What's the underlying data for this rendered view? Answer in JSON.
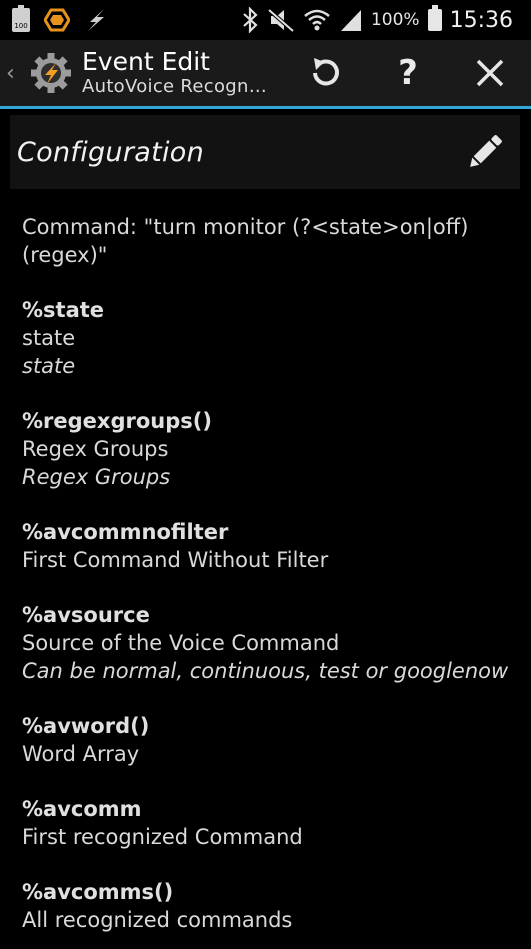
{
  "status_bar": {
    "battery_small_label": "100",
    "battery_percent": "100%",
    "time": "15:36",
    "icons": [
      "battery-small-icon",
      "hexagon-icon",
      "lightning-icon",
      "bluetooth-icon",
      "mute-icon",
      "wifi-icon",
      "signal-icon",
      "battery-icon"
    ]
  },
  "action_bar": {
    "title": "Event Edit",
    "subtitle": "AutoVoice Recogn…",
    "accent_color": "#33a5d9",
    "icons": [
      "back-chevron-icon",
      "app-gear-icon",
      "refresh-icon",
      "help-icon",
      "close-icon"
    ],
    "help_label": "?"
  },
  "config": {
    "title": "Configuration",
    "edit_icon": "pencil-icon",
    "command_text": "Command: \"turn monitor (?<state>on|off) (regex)\"",
    "variables": [
      {
        "name": "%state",
        "label": "state",
        "desc": "state"
      },
      {
        "name": "%regexgroups()",
        "label": "Regex Groups",
        "desc": "Regex Groups"
      },
      {
        "name": "%avcommnofilter",
        "label": "First Command Without Filter",
        "desc": ""
      },
      {
        "name": "%avsource",
        "label": "Source of the Voice Command",
        "desc": "Can be normal, continuous, test or googlenow"
      },
      {
        "name": "%avword()",
        "label": "Word Array",
        "desc": ""
      },
      {
        "name": "%avcomm",
        "label": "First recognized Command",
        "desc": ""
      },
      {
        "name": "%avcomms()",
        "label": "All recognized commands",
        "desc": ""
      }
    ]
  }
}
